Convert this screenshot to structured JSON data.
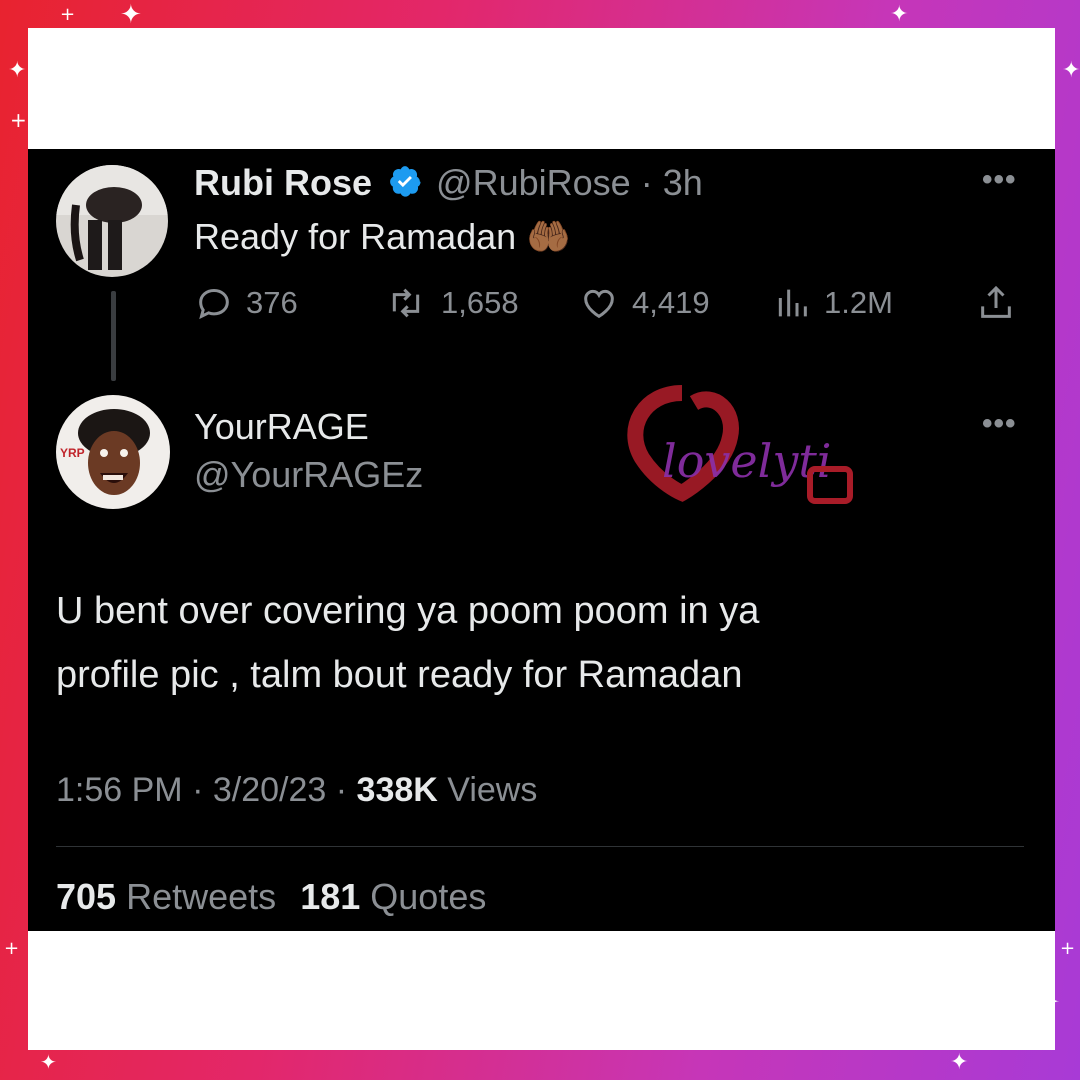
{
  "original_tweet": {
    "author_name": "Rubi Rose",
    "author_handle": "@RubiRose",
    "separator": "·",
    "time_ago": "3h",
    "text": "Ready for Ramadan",
    "emoji": "🤲🏾",
    "replies": "376",
    "retweets": "1,658",
    "likes": "4,419",
    "views": "1.2M"
  },
  "reply_tweet": {
    "author_name": "YourRAGE",
    "author_handle": "@YourRAGEz",
    "text_line1": "U bent over covering ya poom poom in ya",
    "text_line2": "profile pic , talm bout ready for Ramadan",
    "time": "1:56 PM",
    "date": "3/20/23",
    "separator": "·",
    "view_count": "338K",
    "views_label": "Views",
    "retweet_count": "705",
    "retweets_label": "Retweets",
    "quote_count": "181",
    "quotes_label": "Quotes"
  },
  "watermark": {
    "text": "lovelyti"
  },
  "colors": {
    "panel_bg": "#000000",
    "text_primary": "#e7e9ea",
    "text_muted": "#71767b",
    "verified_blue": "#1d9bf0",
    "frame_gradient_start": "#e8232f",
    "frame_gradient_end": "#a83ad6"
  },
  "icons": [
    "verified-badge-icon",
    "more-icon",
    "reply-icon",
    "retweet-icon",
    "like-icon",
    "views-icon",
    "share-icon"
  ]
}
